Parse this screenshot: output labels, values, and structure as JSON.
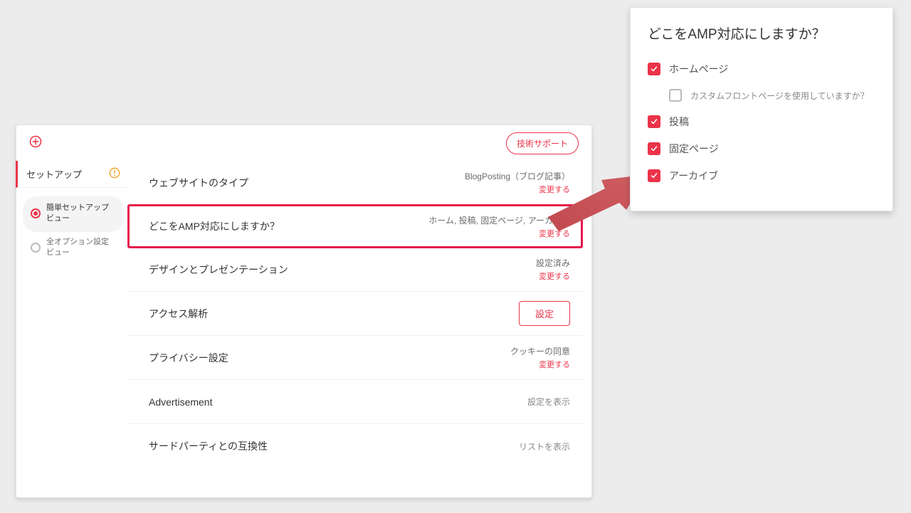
{
  "header": {
    "tech_support": "技術サポート"
  },
  "sidebar": {
    "title": "セットアップ",
    "items": [
      {
        "label": "簡単セットアップビュー",
        "selected": true
      },
      {
        "label": "全オプション設定ビュー",
        "selected": false
      }
    ]
  },
  "rows": [
    {
      "title": "ウェブサイトのタイプ",
      "value": "BlogPosting（ブログ記事）",
      "action": "変更する",
      "type": "change"
    },
    {
      "title": "どこをAMP対応にしますか？",
      "value": "ホーム, 投稿, 固定ページ, アーカイブ",
      "action": "変更する",
      "type": "change",
      "highlight": true
    },
    {
      "title": "デザインとプレゼンテーション",
      "value": "設定済み",
      "action": "変更する",
      "type": "change"
    },
    {
      "title": "アクセス解析",
      "value": "",
      "action": "設定",
      "type": "button"
    },
    {
      "title": "プライバシー設定",
      "value": "クッキーの同意",
      "action": "変更する",
      "type": "change"
    },
    {
      "title": "Advertisement",
      "value": "",
      "action": "設定を表示",
      "type": "muted"
    },
    {
      "title": "サードパーティとの互換性",
      "value": "",
      "action": "リストを表示",
      "type": "muted"
    }
  ],
  "popup": {
    "title": "どこをAMP対応にしますか？",
    "options": [
      {
        "label": "ホームページ",
        "checked": true,
        "sub": {
          "label": "カスタムフロントページを使用していますか？",
          "checked": false
        }
      },
      {
        "label": "投稿",
        "checked": true
      },
      {
        "label": "固定ページ",
        "checked": true
      },
      {
        "label": "アーカイブ",
        "checked": true
      }
    ]
  }
}
